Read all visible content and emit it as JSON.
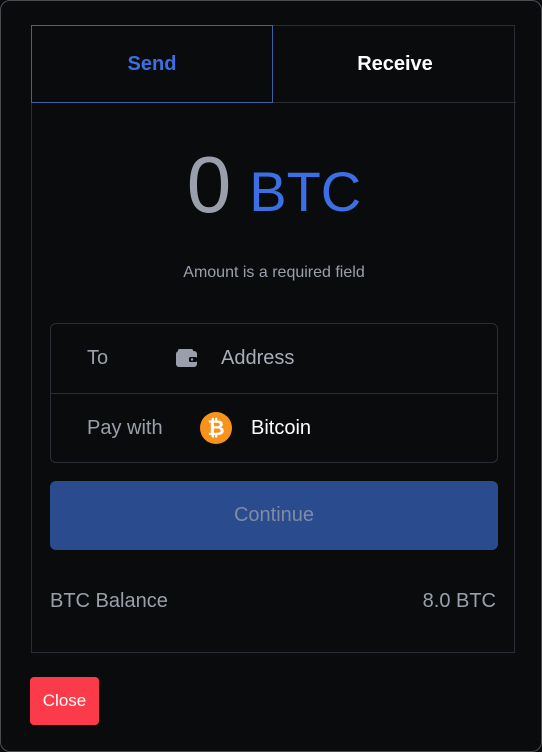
{
  "tabs": [
    {
      "label": "Send",
      "active": true
    },
    {
      "label": "Receive",
      "active": false
    }
  ],
  "amount": {
    "value": "0",
    "unit": "BTC",
    "error": "Amount is a required field"
  },
  "form": {
    "to_label": "To",
    "address_placeholder": "Address",
    "pay_label": "Pay with",
    "pay_value": "Bitcoin",
    "to_icon": "wallet-icon",
    "pay_icon": "bitcoin-icon"
  },
  "continue_label": "Continue",
  "balance": {
    "label": "BTC Balance",
    "value": "8.0 BTC"
  },
  "close_label": "Close",
  "colors": {
    "accent": "#3b6fe3",
    "continue_bg": "#2a4c8f",
    "close_bg": "#fb3a4a",
    "bitcoin": "#f7931a"
  }
}
